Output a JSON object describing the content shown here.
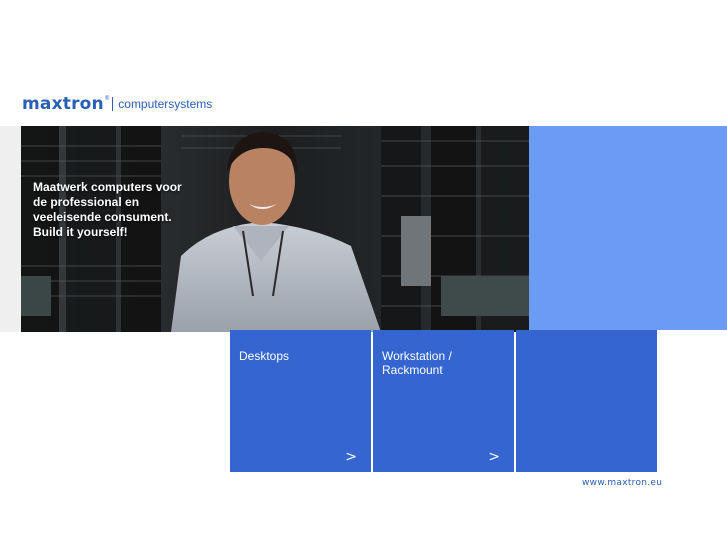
{
  "logo": {
    "brand": "maxtron",
    "registered": "®",
    "subtitle": "computersystems"
  },
  "hero": {
    "image": "server-room-person-photo",
    "tagline_lines": [
      "Maatwerk computers voor",
      "de professional en",
      "veeleisende consument.",
      "Build it yourself!"
    ]
  },
  "tiles": [
    {
      "label": "Desktops",
      "arrow": ">"
    },
    {
      "label": "Workstation / Rackmount",
      "arrow": ">"
    },
    {
      "label": "",
      "arrow": ""
    }
  ],
  "footer": {
    "url": "www.maxtron.eu"
  },
  "colors": {
    "brand_blue": "#2a5fb8",
    "tile_blue": "#3565d0",
    "side_blue": "#6a9bf5"
  }
}
